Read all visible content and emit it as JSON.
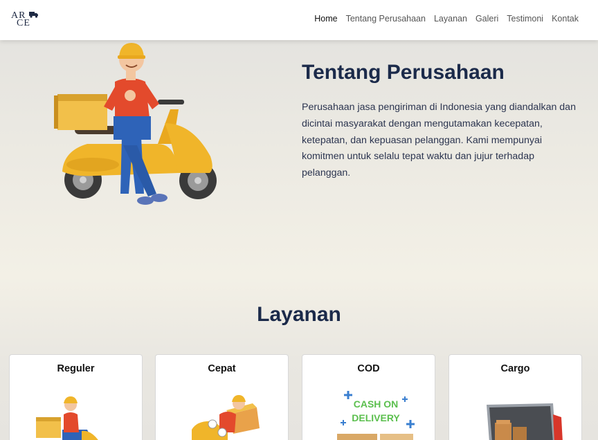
{
  "brand": {
    "logo_line1": "AR",
    "logo_line2": "CE"
  },
  "nav": {
    "items": [
      {
        "label": "Home",
        "active": true
      },
      {
        "label": "Tentang Perusahaan",
        "active": false
      },
      {
        "label": "Layanan",
        "active": false
      },
      {
        "label": "Galeri",
        "active": false
      },
      {
        "label": "Testimoni",
        "active": false
      },
      {
        "label": "Kontak",
        "active": false
      }
    ]
  },
  "about": {
    "title": "Tentang Perusahaan",
    "text": "Perusahaan jasa pengiriman di Indonesia yang diandalkan dan dicintai masyarakat dengan mengutamakan kecepatan, ketepatan, dan kepuasan pelanggan. Kami mempunyai komitmen untuk selalu tepat waktu dan jujur terhadap pelanggan.",
    "illustration": "courier-with-scooter-illustration"
  },
  "services": {
    "title": "Layanan",
    "cards": [
      {
        "title": "Reguler",
        "image": "courier-on-scooter-illustration"
      },
      {
        "title": "Cepat",
        "image": "fast-courier-illustration"
      },
      {
        "title": "COD",
        "image": "cash-on-delivery-illustration",
        "image_text_1": "CASH ON",
        "image_text_2": "DELIVERY"
      },
      {
        "title": "Cargo",
        "image": "cargo-truck-illustration"
      }
    ]
  },
  "colors": {
    "heading": "#1b2a4a",
    "accent_green": "#5bbf4e",
    "accent_blue": "#3a7fd0",
    "scooter_yellow": "#f0b52a",
    "shirt_red": "#e34a2c"
  }
}
